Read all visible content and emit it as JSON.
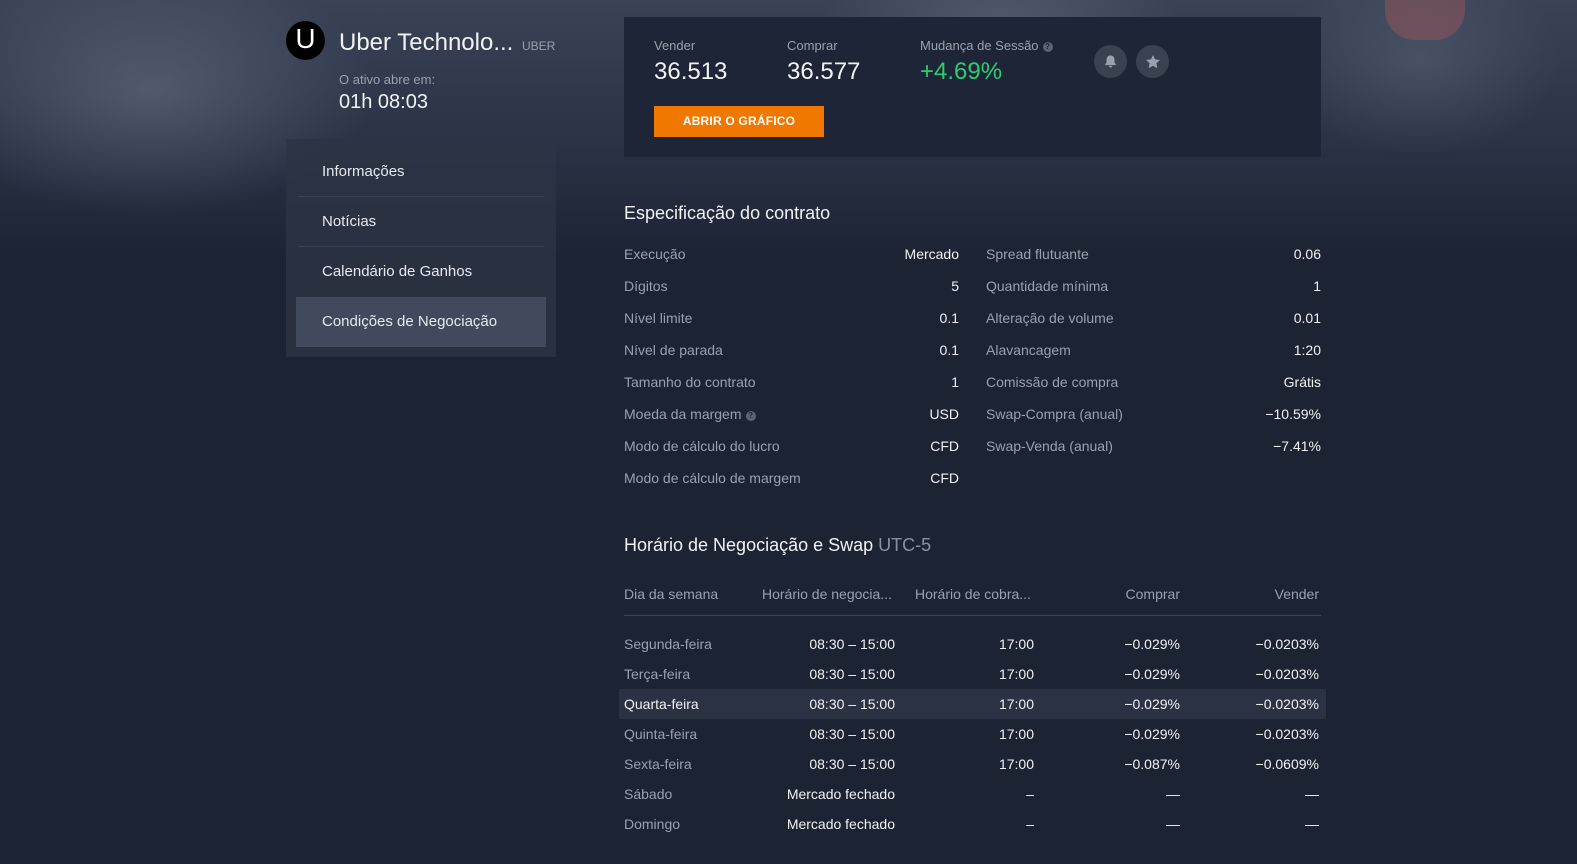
{
  "colors": {
    "background": "#1c2333",
    "panel": "#1e2536",
    "accent": "#f07800",
    "positive": "#2ecc71"
  },
  "asset": {
    "logo_letter": "U",
    "name": "Uber Technolo...",
    "ticker": "UBER",
    "opens_label": "O ativo abre em:",
    "opens_time": "01h 08:03"
  },
  "sidebar": {
    "items": [
      {
        "label": "Informações"
      },
      {
        "label": "Notícias"
      },
      {
        "label": "Calendário de Ganhos"
      },
      {
        "label": "Condições de Negociação",
        "active": true
      }
    ]
  },
  "quote": {
    "sell_label": "Vender",
    "sell_value": "36.513",
    "buy_label": "Comprar",
    "buy_value": "36.577",
    "change_label": "Mudança de Sessão",
    "change_value": "+4.69%",
    "help_glyph": "?",
    "chart_button": "ABRIR O GRÁFICO",
    "icons": [
      "bell-icon",
      "star-icon"
    ]
  },
  "contract": {
    "title": "Especificação do contrato",
    "left": [
      {
        "key": "Execução",
        "value": "Mercado"
      },
      {
        "key": "Dígitos",
        "value": "5"
      },
      {
        "key": "Nível limite",
        "value": "0.1"
      },
      {
        "key": "Nível de parada",
        "value": "0.1"
      },
      {
        "key": "Tamanho do contrato",
        "value": "1"
      },
      {
        "key": "Moeda da margem",
        "value": "USD",
        "help": true
      },
      {
        "key": "Modo de cálculo do lucro",
        "value": "CFD"
      },
      {
        "key": "Modo de cálculo de margem",
        "value": "CFD"
      }
    ],
    "right": [
      {
        "key": "Spread flutuante",
        "value": "0.06"
      },
      {
        "key": "Quantidade mínima",
        "value": "1"
      },
      {
        "key": "Alteração de volume",
        "value": "0.01"
      },
      {
        "key": "Alavancagem",
        "value": "1:20"
      },
      {
        "key": "Comissão de compra",
        "value": "Grátis"
      },
      {
        "key": "Swap-Compra (anual)",
        "value": "−10.59%"
      },
      {
        "key": "Swap-Venda (anual)",
        "value": "−7.41%"
      }
    ]
  },
  "schedule": {
    "title": "Horário de Negociação e Swap",
    "timezone": "UTC-5",
    "headers": [
      "Dia da semana",
      "Horário de negocia...",
      "Horário de cobra...",
      "Comprar",
      "Vender"
    ],
    "rows": [
      {
        "day": "Segunda-feira",
        "hours": "08:30 – 15:00",
        "charge": "17:00",
        "buy": "−0.029%",
        "sell": "−0.0203%"
      },
      {
        "day": "Terça-feira",
        "hours": "08:30 – 15:00",
        "charge": "17:00",
        "buy": "−0.029%",
        "sell": "−0.0203%"
      },
      {
        "day": "Quarta-feira",
        "hours": "08:30 – 15:00",
        "charge": "17:00",
        "buy": "−0.029%",
        "sell": "−0.0203%",
        "highlight": true
      },
      {
        "day": "Quinta-feira",
        "hours": "08:30 – 15:00",
        "charge": "17:00",
        "buy": "−0.029%",
        "sell": "−0.0203%"
      },
      {
        "day": "Sexta-feira",
        "hours": "08:30 – 15:00",
        "charge": "17:00",
        "buy": "−0.087%",
        "sell": "−0.0609%"
      },
      {
        "day": "Sábado",
        "hours": "Mercado fechado",
        "charge": "–",
        "buy": "—",
        "sell": "—"
      },
      {
        "day": "Domingo",
        "hours": "Mercado fechado",
        "charge": "–",
        "buy": "—",
        "sell": "—"
      }
    ]
  }
}
